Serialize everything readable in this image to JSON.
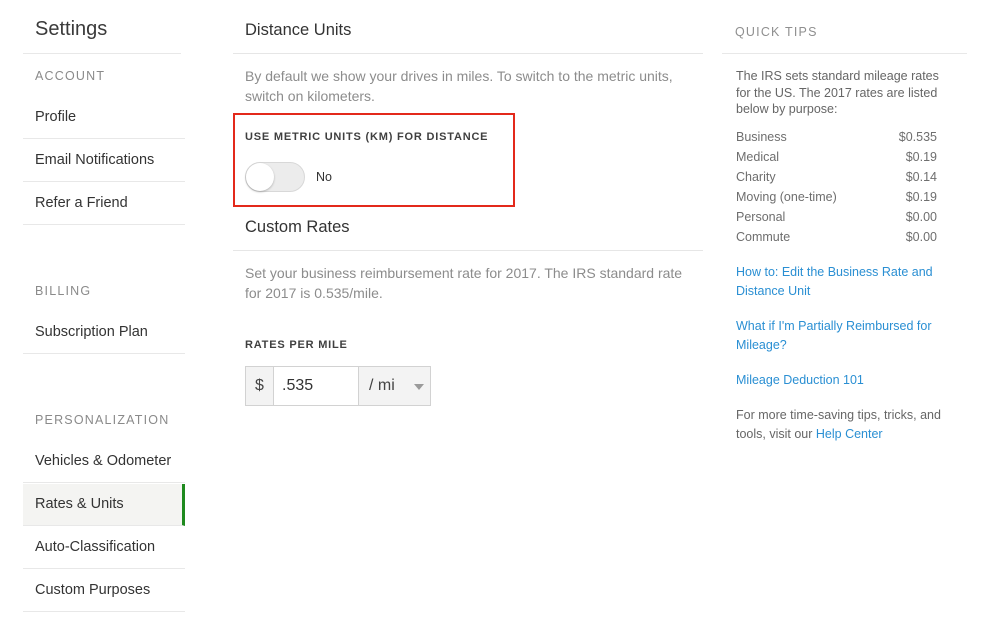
{
  "sidebar": {
    "title": "Settings",
    "sections": [
      {
        "label": "ACCOUNT",
        "items": [
          {
            "label": "Profile"
          },
          {
            "label": "Email Notifications"
          },
          {
            "label": "Refer a Friend"
          }
        ]
      },
      {
        "label": "BILLING",
        "items": [
          {
            "label": "Subscription Plan"
          }
        ]
      },
      {
        "label": "PERSONALIZATION",
        "items": [
          {
            "label": "Vehicles & Odometer"
          },
          {
            "label": "Rates & Units",
            "active": true
          },
          {
            "label": "Auto-Classification"
          },
          {
            "label": "Custom Purposes"
          }
        ]
      }
    ]
  },
  "main": {
    "distance_units": {
      "heading": "Distance Units",
      "description": "By default we show your drives in miles. To switch to the metric units, switch on kilometers.",
      "toggle_label": "USE METRIC UNITS (KM) FOR DISTANCE",
      "toggle_value": "No",
      "toggle_on": false
    },
    "custom_rates": {
      "heading": "Custom Rates",
      "description": "Set your business reimbursement rate for 2017. The IRS standard rate for 2017 is 0.535/mile.",
      "rates_label": "RATES PER MILE",
      "currency_symbol": "$",
      "rate_value": ".535",
      "unit_selected": "/ mi"
    }
  },
  "tips": {
    "title": "QUICK TIPS",
    "intro": "The IRS sets standard mileage rates for the US. The 2017 rates are listed below by purpose:",
    "rates": [
      {
        "purpose": "Business",
        "rate": "$0.535"
      },
      {
        "purpose": "Medical",
        "rate": "$0.19"
      },
      {
        "purpose": "Charity",
        "rate": "$0.14"
      },
      {
        "purpose": "Moving (one-time)",
        "rate": "$0.19"
      },
      {
        "purpose": "Personal",
        "rate": "$0.00"
      },
      {
        "purpose": "Commute",
        "rate": "$0.00"
      }
    ],
    "links": [
      {
        "label": "How to: Edit the Business Rate and Distance Unit"
      },
      {
        "label": "What if I'm Partially Reimbursed for Mileage?"
      },
      {
        "label": "Mileage Deduction 101"
      }
    ],
    "footer_text": "For more time-saving tips, tricks, and tools, visit our ",
    "footer_link": "Help Center"
  },
  "colors": {
    "accent_active": "#1e8a1e",
    "highlight_border": "#e3291b",
    "link": "#2a8fd3"
  }
}
